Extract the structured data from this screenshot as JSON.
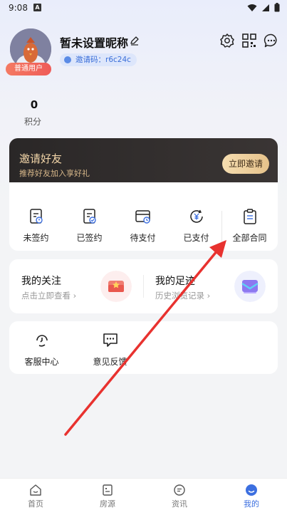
{
  "status_bar": {
    "time": "9:08",
    "notification_glyph": "A"
  },
  "profile": {
    "nickname": "暂未设置昵称",
    "invite_code": "邀请码：r6c24c",
    "user_level": "普通用户"
  },
  "stats": {
    "points_value": "0",
    "points_label": "积分"
  },
  "invite_banner": {
    "title": "邀请好友",
    "subtitle": "推荐好友加入享好礼",
    "button_label": "立即邀请"
  },
  "contracts": [
    {
      "label": "未签约",
      "icon": "contract-pending-icon"
    },
    {
      "label": "已签约",
      "icon": "contract-signed-icon"
    },
    {
      "label": "待支付",
      "icon": "payment-pending-icon"
    },
    {
      "label": "已支付",
      "icon": "paid-yuan-icon"
    },
    {
      "label": "全部合同",
      "icon": "all-contracts-icon"
    }
  ],
  "follow": {
    "my_follow_title": "我的关注",
    "my_follow_sub": "点击立即查看",
    "my_footprint_title": "我的足迹",
    "my_footprint_sub": "历史浏览记录"
  },
  "services": [
    {
      "label": "客服中心",
      "icon": "customer-service-icon"
    },
    {
      "label": "意见反馈",
      "icon": "feedback-icon"
    }
  ],
  "bottom_nav": [
    {
      "label": "首页",
      "icon": "home-icon",
      "active": false
    },
    {
      "label": "房源",
      "icon": "listings-icon",
      "active": false
    },
    {
      "label": "资讯",
      "icon": "news-icon",
      "active": false
    },
    {
      "label": "我的",
      "icon": "profile-icon",
      "active": true
    }
  ],
  "colors": {
    "accent": "#3c6fe0",
    "invite_gold": "#f3d6a9",
    "badge_red": "#ef5b58",
    "annotation_red": "#e8322f"
  }
}
